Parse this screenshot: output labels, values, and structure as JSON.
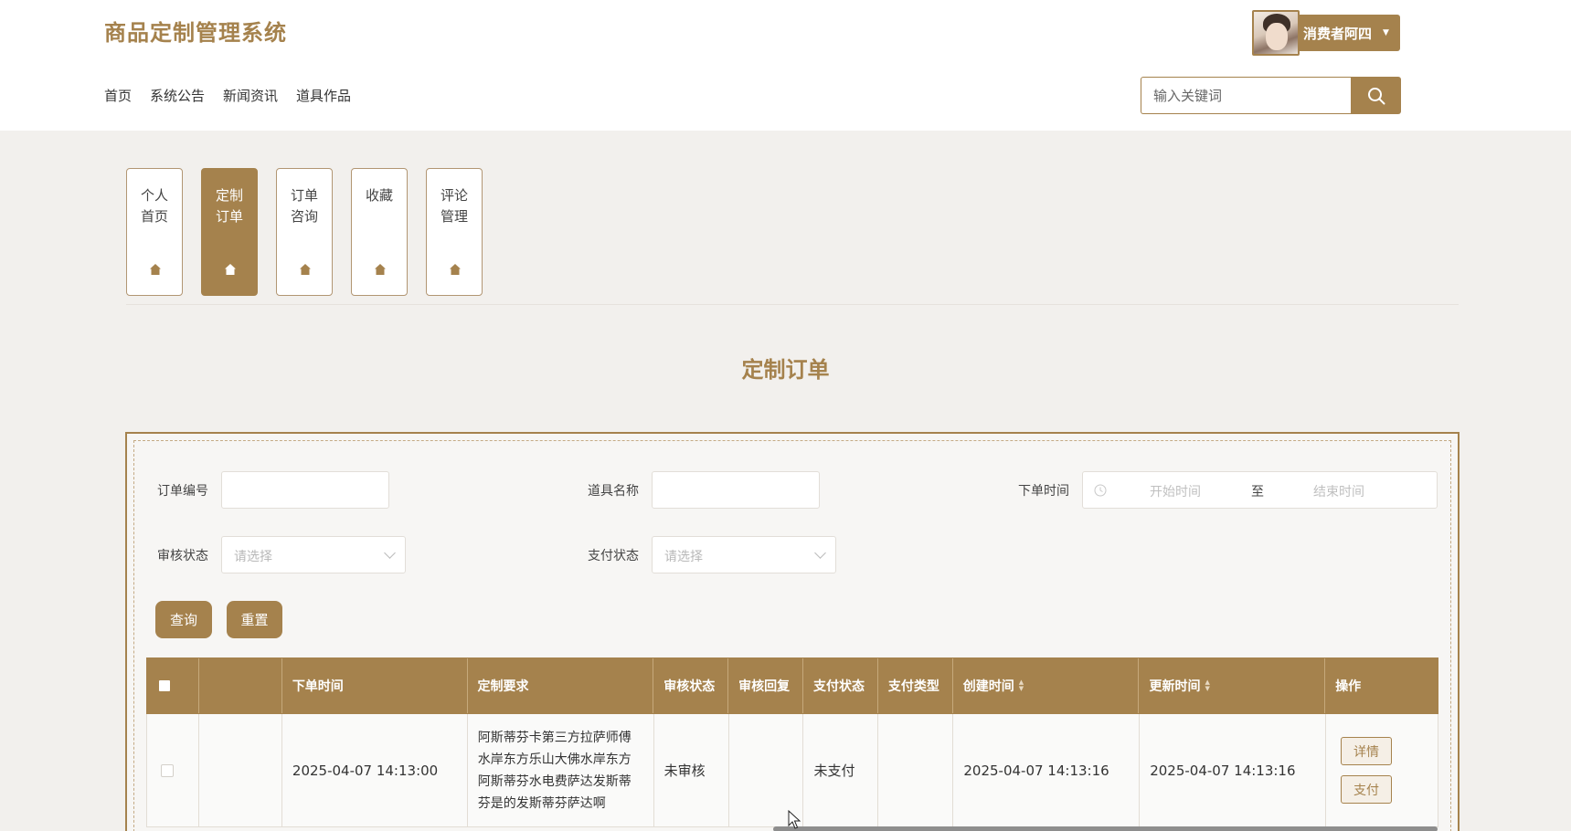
{
  "header": {
    "site_title": "商品定制管理系统",
    "user_name": "消费者阿四",
    "nav": [
      "首页",
      "系统公告",
      "新闻资讯",
      "道具作品"
    ],
    "search_placeholder": "输入关键词"
  },
  "tabs": [
    {
      "label": "个人首页",
      "active": false
    },
    {
      "label": "定制订单",
      "active": true
    },
    {
      "label": "订单咨询",
      "active": false
    },
    {
      "label": "收藏",
      "active": false
    },
    {
      "label": "评论管理",
      "active": false
    }
  ],
  "page_title": "定制订单",
  "filters": {
    "order_no_label": "订单编号",
    "prop_name_label": "道具名称",
    "order_time_label": "下单时间",
    "start_placeholder": "开始时间",
    "range_sep": "至",
    "end_placeholder": "结束时间",
    "audit_status_label": "审核状态",
    "pay_status_label": "支付状态",
    "select_placeholder": "请选择",
    "query_button": "查询",
    "reset_button": "重置"
  },
  "table": {
    "columns": [
      "下单时间",
      "定制要求",
      "审核状态",
      "审核回复",
      "支付状态",
      "支付类型",
      "创建时间",
      "更新时间",
      "操作"
    ],
    "rows": [
      {
        "order_time": "2025-04-07 14:13:00",
        "requirement": "阿斯蒂芬卡第三方拉萨师傅水岸东方乐山大佛水岸东方阿斯蒂芬水电费萨达发斯蒂芬是的发斯蒂芬萨达啊",
        "audit_status": "未审核",
        "audit_reply": "",
        "pay_status": "未支付",
        "pay_type": "",
        "created": "2025-04-07 14:13:16",
        "updated": "2025-04-07 14:13:16",
        "actions": [
          "详情",
          "支付"
        ]
      }
    ]
  },
  "colors": {
    "accent": "#a5824d",
    "background": "#f2f0ed"
  }
}
